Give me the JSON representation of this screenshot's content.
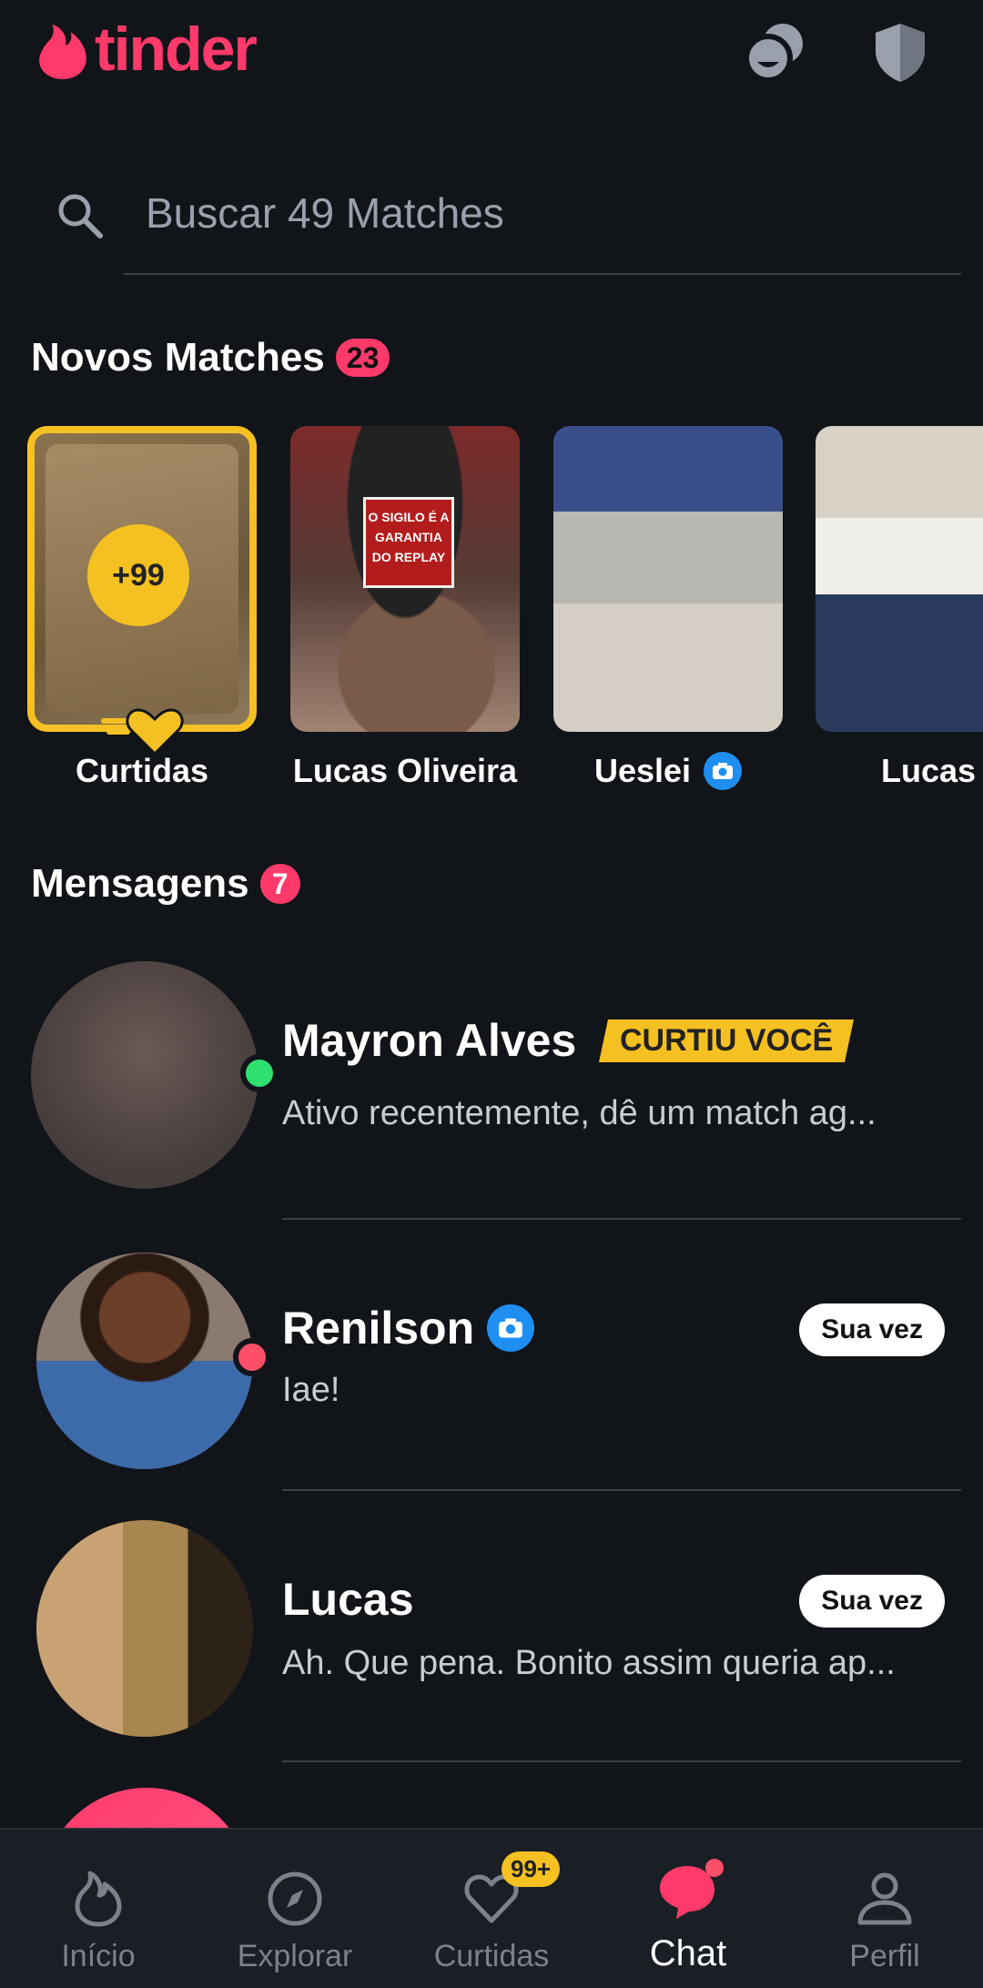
{
  "header": {
    "logo_text": "tinder",
    "match_icon": "double-match-icon",
    "shield_icon": "safety-shield-icon"
  },
  "search": {
    "placeholder": "Buscar 49 Matches"
  },
  "new_matches": {
    "title": "Novos Matches",
    "count": "23",
    "likes_card": {
      "count": "+99",
      "label": "Curtidas"
    },
    "items": [
      {
        "name": "Lucas Oliveira",
        "caption": "O SIGILO É A GARANTIA DO REPLAY"
      },
      {
        "name": "Ueslei"
      },
      {
        "name": "Lucas"
      }
    ]
  },
  "messages": {
    "title": "Mensagens",
    "count": "7",
    "items": [
      {
        "name": "Mayron Alves",
        "badge": "CURTIU VOCÊ",
        "preview": "Ativo recentemente, dê um match ag..."
      },
      {
        "name": "Renilson",
        "action": "Sua vez",
        "preview": "Iae!"
      },
      {
        "name": "Lucas",
        "action": "Sua vez",
        "preview": "Ah. Que pena. Bonito assim queria ap..."
      }
    ]
  },
  "bottom_nav": {
    "items": [
      {
        "label": "Início",
        "icon": "flame-icon"
      },
      {
        "label": "Explorar",
        "icon": "compass-icon"
      },
      {
        "label": "Curtidas",
        "icon": "heart-icon",
        "badge": "99+"
      },
      {
        "label": "Chat",
        "icon": "chat-icon",
        "active": true
      },
      {
        "label": "Perfil",
        "icon": "profile-icon"
      }
    ]
  },
  "colors": {
    "background": "#111419",
    "brand": "#fd3a6a",
    "gold": "#f5c021",
    "online": "#2ee06e",
    "verified": "#1e8ff0"
  }
}
